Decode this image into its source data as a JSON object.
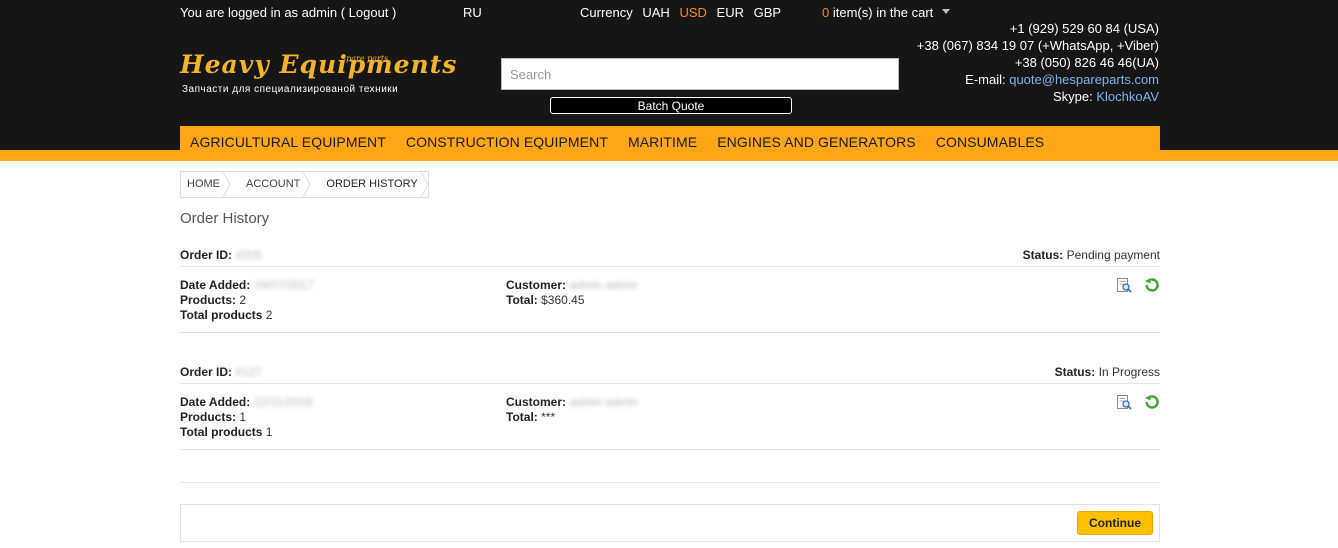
{
  "header": {
    "login_prefix": "You are logged in as admin (",
    "logout_label": "Logout",
    "login_suffix": ")",
    "language": "RU",
    "currency_label": "Currency",
    "currencies": [
      "UAH",
      "USD",
      "EUR",
      "GBP"
    ],
    "active_currency": "USD",
    "cart_count": "0",
    "cart_text": "item(s) in the cart",
    "phone_usa": "+1 (929) 529 60 84 (USA)",
    "phone_whatsapp": "+38 (067) 834 19 07 (+WhatsApp, +Viber)",
    "phone_ua": "+38 (050) 826 46 46(UA)",
    "email_label": "E-mail:",
    "email": "quote@hespareparts.com",
    "skype_label": "Skype:",
    "skype": "KlochkoAV",
    "logo_main": "Heavy Equipments",
    "logo_tag": "spare parts",
    "logo_sub": "Запчасти для специализированой техники",
    "search_placeholder": "Search",
    "batch_quote": "Batch Quote"
  },
  "nav": {
    "items": [
      "AGRICULTURAL EQUIPMENT",
      "CONSTRUCTION EQUIPMENT",
      "MARITIME",
      "ENGINES AND GENERATORS",
      "CONSUMABLES"
    ]
  },
  "breadcrumb": [
    "HOME",
    "ACCOUNT",
    "ORDER HISTORY"
  ],
  "page_title": "Order History",
  "orders": [
    {
      "id_label": "Order ID:",
      "id": "#205",
      "status_label": "Status:",
      "status": "Pending payment",
      "date_label": "Date Added:",
      "date": "24/07/2017",
      "products_label": "Products:",
      "products": "2",
      "total_products_label": "Total products",
      "total_products": "2",
      "customer_label": "Customer:",
      "customer": "admin admin",
      "total_label": "Total:",
      "total": "$360.45"
    },
    {
      "id_label": "Order ID:",
      "id": "#127",
      "status_label": "Status:",
      "status": "In Progress",
      "date_label": "Date Added:",
      "date": "12/11/2016",
      "products_label": "Products:",
      "products": "1",
      "total_products_label": "Total products",
      "total_products": "1",
      "customer_label": "Customer:",
      "customer": "admin admin",
      "total_label": "Total:",
      "total": "***"
    }
  ],
  "continue_label": "Continue",
  "icons": {
    "view": "view-order-icon",
    "reorder": "reorder-icon"
  },
  "colors": {
    "accent": "#ffa617",
    "header_bg": "#161616",
    "active_currency": "#ff8a1f",
    "link": "#7fb2ef",
    "button": "#ffc000"
  }
}
